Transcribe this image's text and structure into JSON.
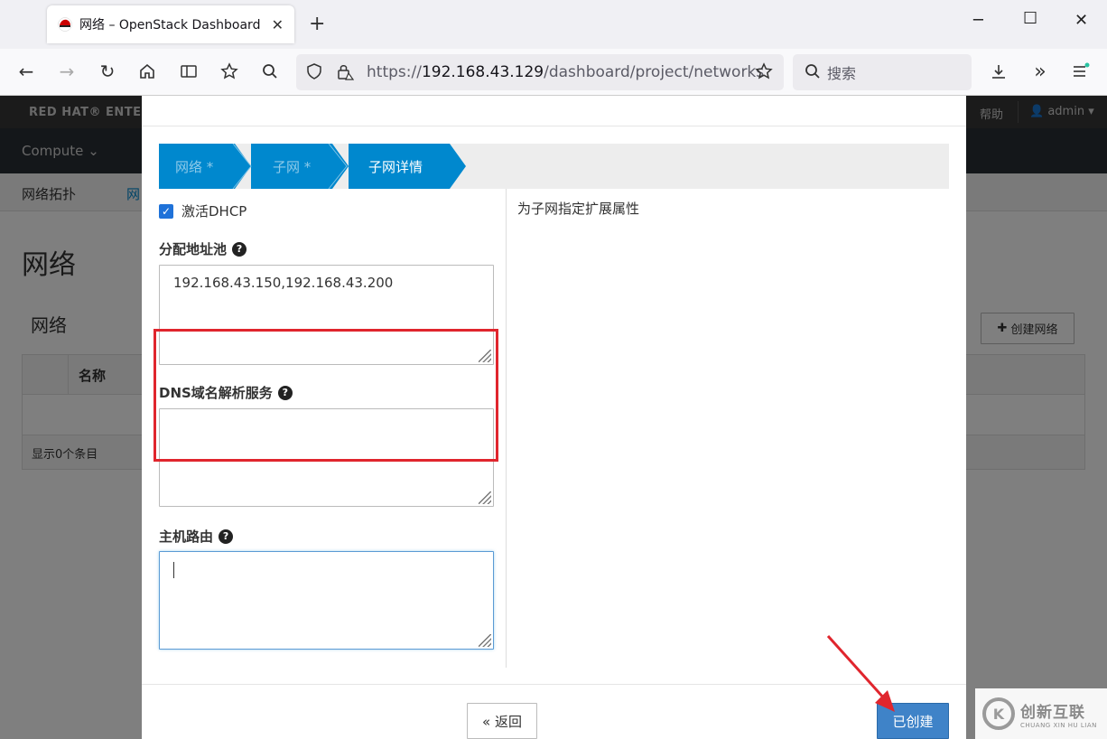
{
  "browser": {
    "tab_title": "网络 – OpenStack Dashboard",
    "url_prefix": "https://",
    "url_host": "192.168.43.129",
    "url_path": "/dashboard/project/networks",
    "search_placeholder": "搜索"
  },
  "dashboard": {
    "brand": "RED HAT® ENTER",
    "help": "帮助",
    "user": "admin",
    "compute_menu": "Compute",
    "subnav_topology": "网络拓扑",
    "subnav_networks": "网",
    "page_title": "网络",
    "section_title": "网络",
    "create_network_button": "创建网络",
    "table_col_name": "名称",
    "table_footer": "显示0个条目"
  },
  "modal": {
    "steps": [
      {
        "label": "网络 *",
        "state": "done"
      },
      {
        "label": "子网 *",
        "state": "done"
      },
      {
        "label": "子网详情",
        "state": "active"
      }
    ],
    "dhcp_label": "激活DHCP",
    "dhcp_checked": true,
    "pool_label": "分配地址池",
    "pool_value": "192.168.43.150,192.168.43.200",
    "dns_label": "DNS域名解析服务",
    "dns_value": "",
    "routes_label": "主机路由",
    "routes_value": "",
    "description": "为子网指定扩展属性",
    "back_button": "« 返回",
    "create_button": "已创建"
  },
  "watermark": {
    "logo_glyph": "K",
    "cn": "创新互联",
    "en": "CHUANG XIN HU LIAN"
  },
  "colors": {
    "wizard_active": "#0088ce",
    "primary_button": "#3f83c8",
    "highlight": "#e0252d"
  }
}
